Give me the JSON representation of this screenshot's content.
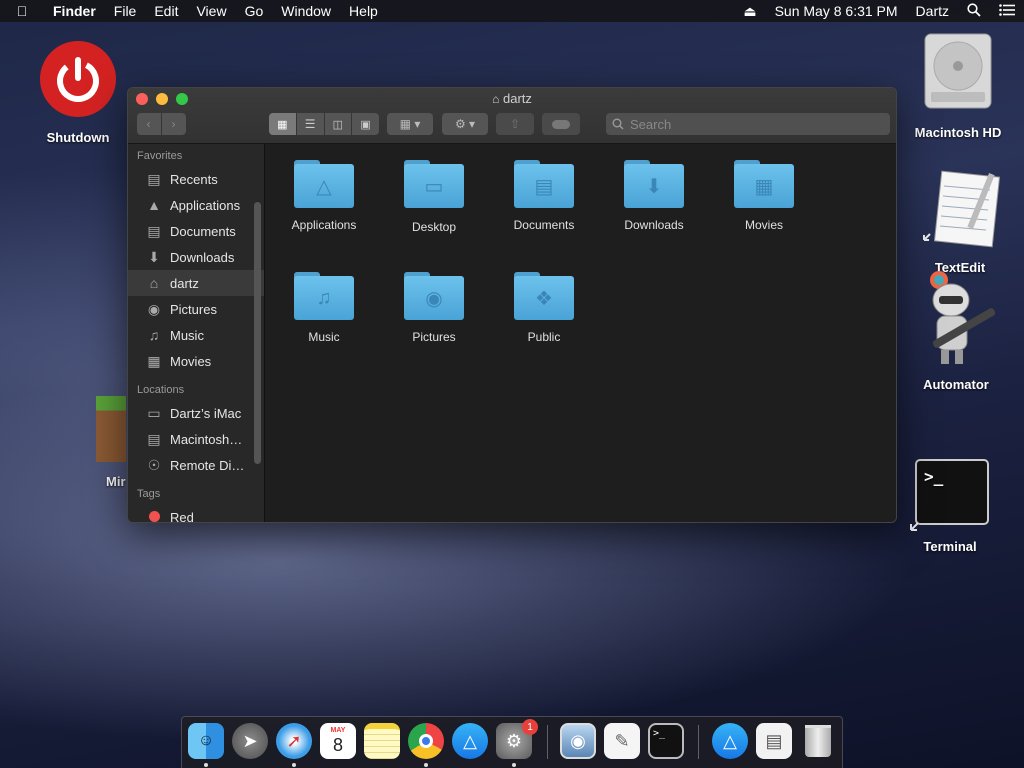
{
  "menubar": {
    "app": "Finder",
    "items": [
      "File",
      "Edit",
      "View",
      "Go",
      "Window",
      "Help"
    ],
    "clock": "Sun May 8  6:31 PM",
    "user": "Dartz"
  },
  "desktop": {
    "shutdown": "Shutdown",
    "hd": "Macintosh HD",
    "textedit": "TextEdit",
    "automator": "Automator",
    "terminal": "Terminal",
    "minecraft": "Mir"
  },
  "window": {
    "title": "dartz",
    "search_placeholder": "Search"
  },
  "sidebar": {
    "favorites_header": "Favorites",
    "favorites": [
      "Recents",
      "Applications",
      "Documents",
      "Downloads",
      "dartz",
      "Pictures",
      "Music",
      "Movies"
    ],
    "locations_header": "Locations",
    "locations": [
      "Dartz’s iMac",
      "Macintosh…",
      "Remote Di…"
    ],
    "tags_header": "Tags",
    "tags": [
      "Red"
    ]
  },
  "folders": [
    "Applications",
    "Desktop",
    "Documents",
    "Downloads",
    "Movies",
    "Music",
    "Pictures",
    "Public"
  ],
  "dock": {
    "calendar_month": "MAY",
    "calendar_day": "8",
    "prefs_badge": "1"
  },
  "colors": {
    "folder": "#5bb3e3",
    "close": "#fc605c",
    "min": "#fdbc40",
    "max": "#34c84a"
  }
}
